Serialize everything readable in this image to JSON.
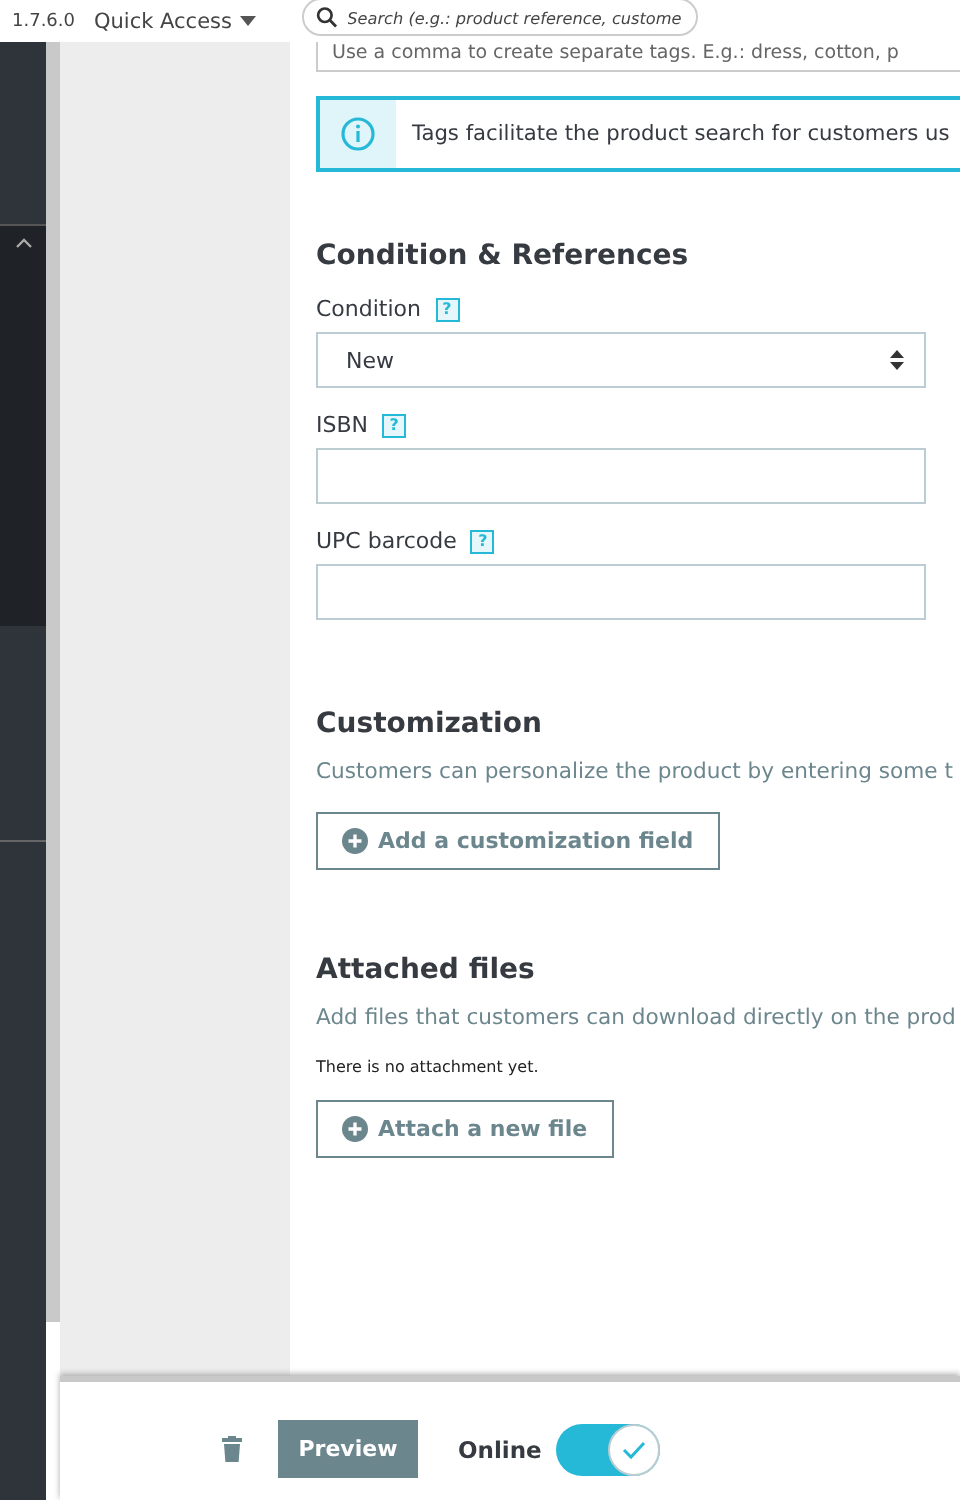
{
  "header": {
    "version": "1.7.6.0",
    "quick_access": "Quick Access",
    "search": {
      "placeholder": "Search (e.g.: product reference, custome"
    }
  },
  "tags_hint": "Use a comma to create separate tags. E.g.: dress, cotton, p",
  "info_alert": "Tags facilitate the product search for customers us",
  "condition_section": {
    "title": "Condition & References",
    "fields": [
      {
        "kind": "select",
        "label": "Condition",
        "help": "?",
        "value": "New"
      },
      {
        "kind": "text",
        "label": "ISBN",
        "help": "?"
      },
      {
        "kind": "text",
        "label": "UPC barcode",
        "help": "?"
      }
    ]
  },
  "customization": {
    "title": "Customization",
    "description": "Customers can personalize the product by entering some t",
    "button": "Add a customization field"
  },
  "attached_files": {
    "title": "Attached files",
    "description": "Add files that customers can download directly on the prod",
    "empty_note": "There is no attachment yet.",
    "button": "Attach a new file"
  },
  "footer": {
    "preview_button": "Preview",
    "online": {
      "label": "Online",
      "on": true
    }
  }
}
